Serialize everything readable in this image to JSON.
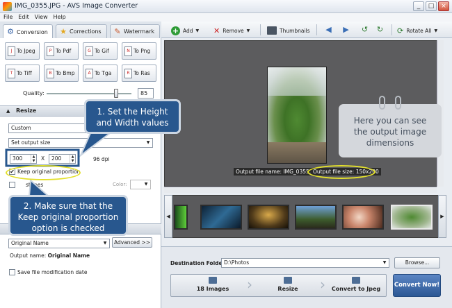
{
  "window": {
    "title": "IMG_0355.JPG - AVS Image Converter",
    "minimize": "_",
    "maximize": "□",
    "close": "×"
  },
  "menu": [
    "File",
    "Edit",
    "View",
    "Help"
  ],
  "tabs": [
    {
      "label": "Conversion",
      "icon": "gear-icon"
    },
    {
      "label": "Corrections",
      "icon": "star-icon"
    },
    {
      "label": "Watermark",
      "icon": "watermark-icon"
    }
  ],
  "formats": [
    "To Jpeg",
    "To Pdf",
    "To Gif",
    "To Png",
    "To Tiff",
    "To Bmp",
    "To Tga",
    "To Ras"
  ],
  "quality": {
    "label": "Quality:",
    "value": "85",
    "fraction": 0.82
  },
  "resize": {
    "header": "Resize",
    "preset": "Custom",
    "mode": "Set output size",
    "width": "300",
    "x_label": "X",
    "height": "200",
    "dpi": "96 dpi",
    "keep_proportion_label": "Keep original proportion",
    "keep_proportion_checked": true,
    "stripes_label": "stripes",
    "color_label": "Color:"
  },
  "naming": {
    "select_value": "Original Name",
    "advanced_label": "Advanced >>",
    "output_name_label": "Output name:",
    "output_name_value": "Original Name",
    "save_date_label": "Save file modification date"
  },
  "toolbar": {
    "add": "Add",
    "remove": "Remove",
    "thumbnails": "Thumbnails",
    "rotate_all": "Rotate All"
  },
  "preview": {
    "output_name": "Output file name: IMG_0355.jpg",
    "output_size": "Output file size: 150x200"
  },
  "destination": {
    "label": "Destination Folder:",
    "value": "D:\\Photos",
    "browse": "Browse..."
  },
  "steps": {
    "images": "18 Images",
    "resize": "Resize",
    "convert_to": "Convert to Jpeg",
    "convert_now": "Convert Now!"
  },
  "callouts": {
    "one_line1": "1. Set the Height",
    "one_line2": "and Width values",
    "two_line1": "2. Make sure that the",
    "two_line2": "Keep original proportion",
    "two_line3": "option is checked",
    "gray_line1": "Here you can see",
    "gray_line2": "the output image",
    "gray_line3": "dimensions"
  },
  "colors": {
    "callout_blue": "#28578e",
    "highlight_yellow": "#e3e02c",
    "preview_bg": "#5c5c5e"
  }
}
